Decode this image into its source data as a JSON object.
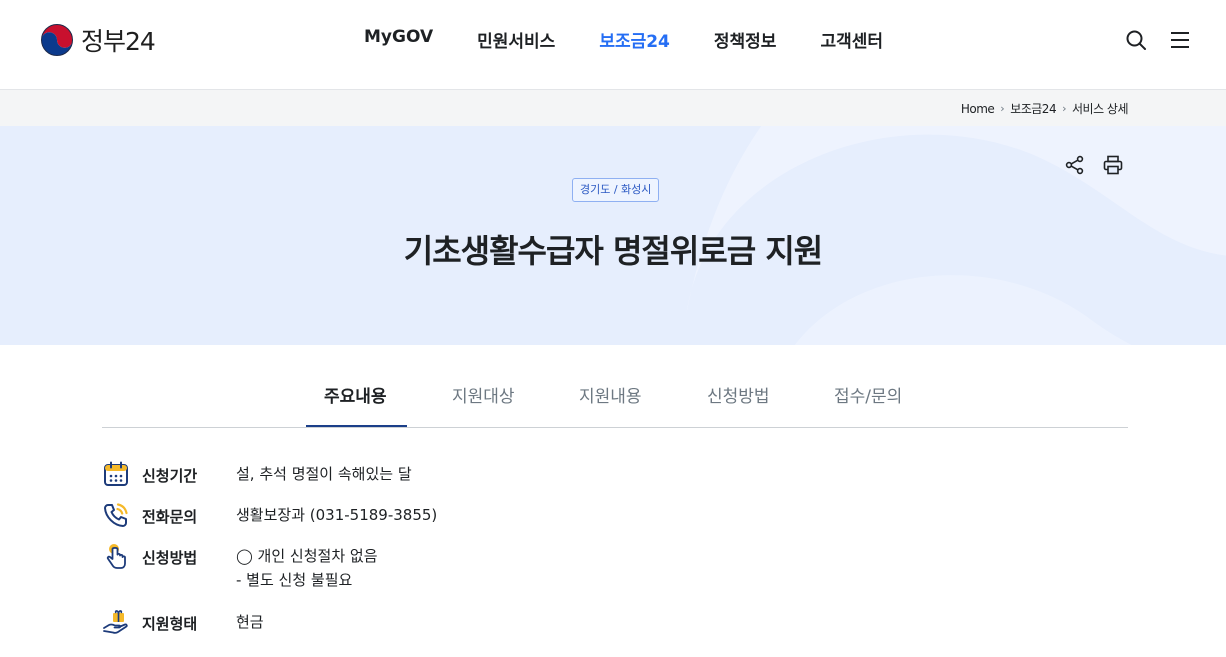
{
  "header": {
    "logo_text": "정부24",
    "nav": [
      "MyGOV",
      "민원서비스",
      "보조금24",
      "정책정보",
      "고객센터"
    ],
    "active_nav": "보조금24",
    "icons": [
      "search-icon",
      "menu-icon"
    ]
  },
  "breadcrumb": [
    "Home",
    "보조금24",
    "서비스 상세"
  ],
  "hero": {
    "region": "경기도 / 화성시",
    "title": "기초생활수급자 명절위로금 지원",
    "icons": [
      "share-icon",
      "print-icon"
    ]
  },
  "tabs": [
    "주요내용",
    "지원대상",
    "지원내용",
    "신청방법",
    "접수/문의"
  ],
  "active_tab": "주요내용",
  "details": [
    {
      "label": "신청기간",
      "icon": "calendar-icon",
      "lines": [
        "설, 추석 명절이 속해있는 달"
      ]
    },
    {
      "label": "전화문의",
      "icon": "phone-icon",
      "lines": [
        "생활보장과 (031-5189-3855)"
      ]
    },
    {
      "label": "신청방법",
      "icon": "click-hand-icon",
      "lines": [
        "◯ 개인 신청절차 없음",
        "- 별도 신청 불필요"
      ]
    },
    {
      "label": "지원형태",
      "icon": "gift-hand-icon",
      "lines": [
        "현금"
      ]
    }
  ],
  "colors": {
    "accent": "#256ef4",
    "hero_bg": "#e6eefd",
    "navy": "#1b3f89",
    "icon_yellow": "#f5b92a",
    "icon_navy": "#1d3b7a"
  }
}
